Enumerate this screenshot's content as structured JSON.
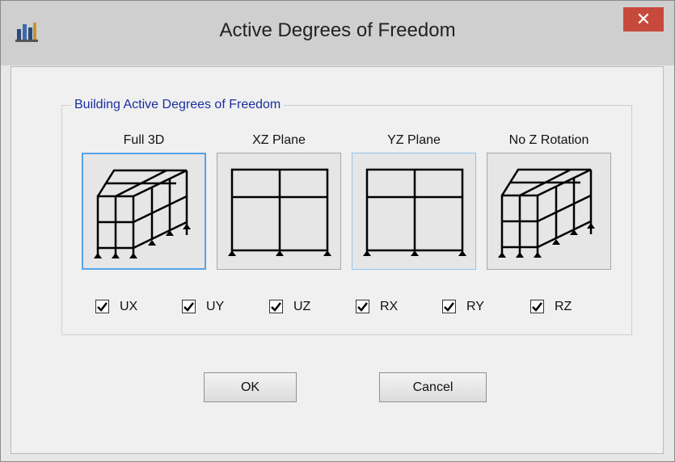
{
  "window": {
    "title": "Active Degrees of Freedom"
  },
  "group": {
    "label": "Building Active Degrees of Freedom"
  },
  "options": [
    {
      "label": "Full 3D",
      "icon": "3d-frame-icon",
      "selected": true
    },
    {
      "label": "XZ Plane",
      "icon": "plane-frame-icon",
      "selected": false
    },
    {
      "label": "YZ Plane",
      "icon": "plane-frame-icon",
      "selected": false
    },
    {
      "label": "No Z Rotation",
      "icon": "3d-frame-icon",
      "selected": false
    }
  ],
  "dofs": [
    {
      "label": "UX",
      "checked": true
    },
    {
      "label": "UY",
      "checked": true
    },
    {
      "label": "UZ",
      "checked": true
    },
    {
      "label": "RX",
      "checked": true
    },
    {
      "label": "RY",
      "checked": true
    },
    {
      "label": "RZ",
      "checked": true
    }
  ],
  "buttons": {
    "ok": "OK",
    "cancel": "Cancel"
  },
  "colors": {
    "close": "#c7493c",
    "group_label": "#1a2ea0",
    "selected_border": "#56a3e8"
  }
}
